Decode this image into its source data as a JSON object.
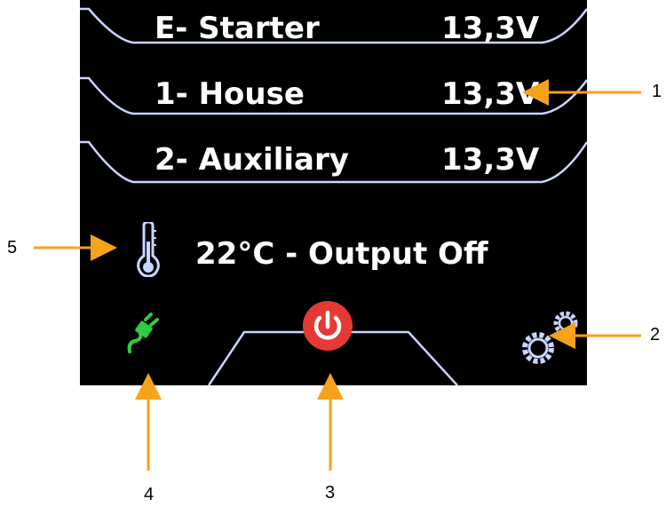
{
  "batteries": [
    {
      "label": "E- Starter",
      "voltage": "13,3V"
    },
    {
      "label": "1- House",
      "voltage": "13,3V"
    },
    {
      "label": "2- Auxiliary",
      "voltage": "13,3V"
    }
  ],
  "status": {
    "text": "22°C - Output Off",
    "temperature_icon": "thermometer-icon"
  },
  "bottom_bar": {
    "plug_icon": "plug-icon",
    "power_icon": "power-icon",
    "settings_icon": "gears-icon"
  },
  "callouts": [
    "1",
    "2",
    "3",
    "4",
    "5"
  ],
  "colors": {
    "screen_bg": "#000000",
    "frame_line": "#c9d6ff",
    "text": "#ffffff",
    "plug_green": "#2ecc40",
    "power_red": "#e53935",
    "arrow_orange": "#f7a21b"
  }
}
